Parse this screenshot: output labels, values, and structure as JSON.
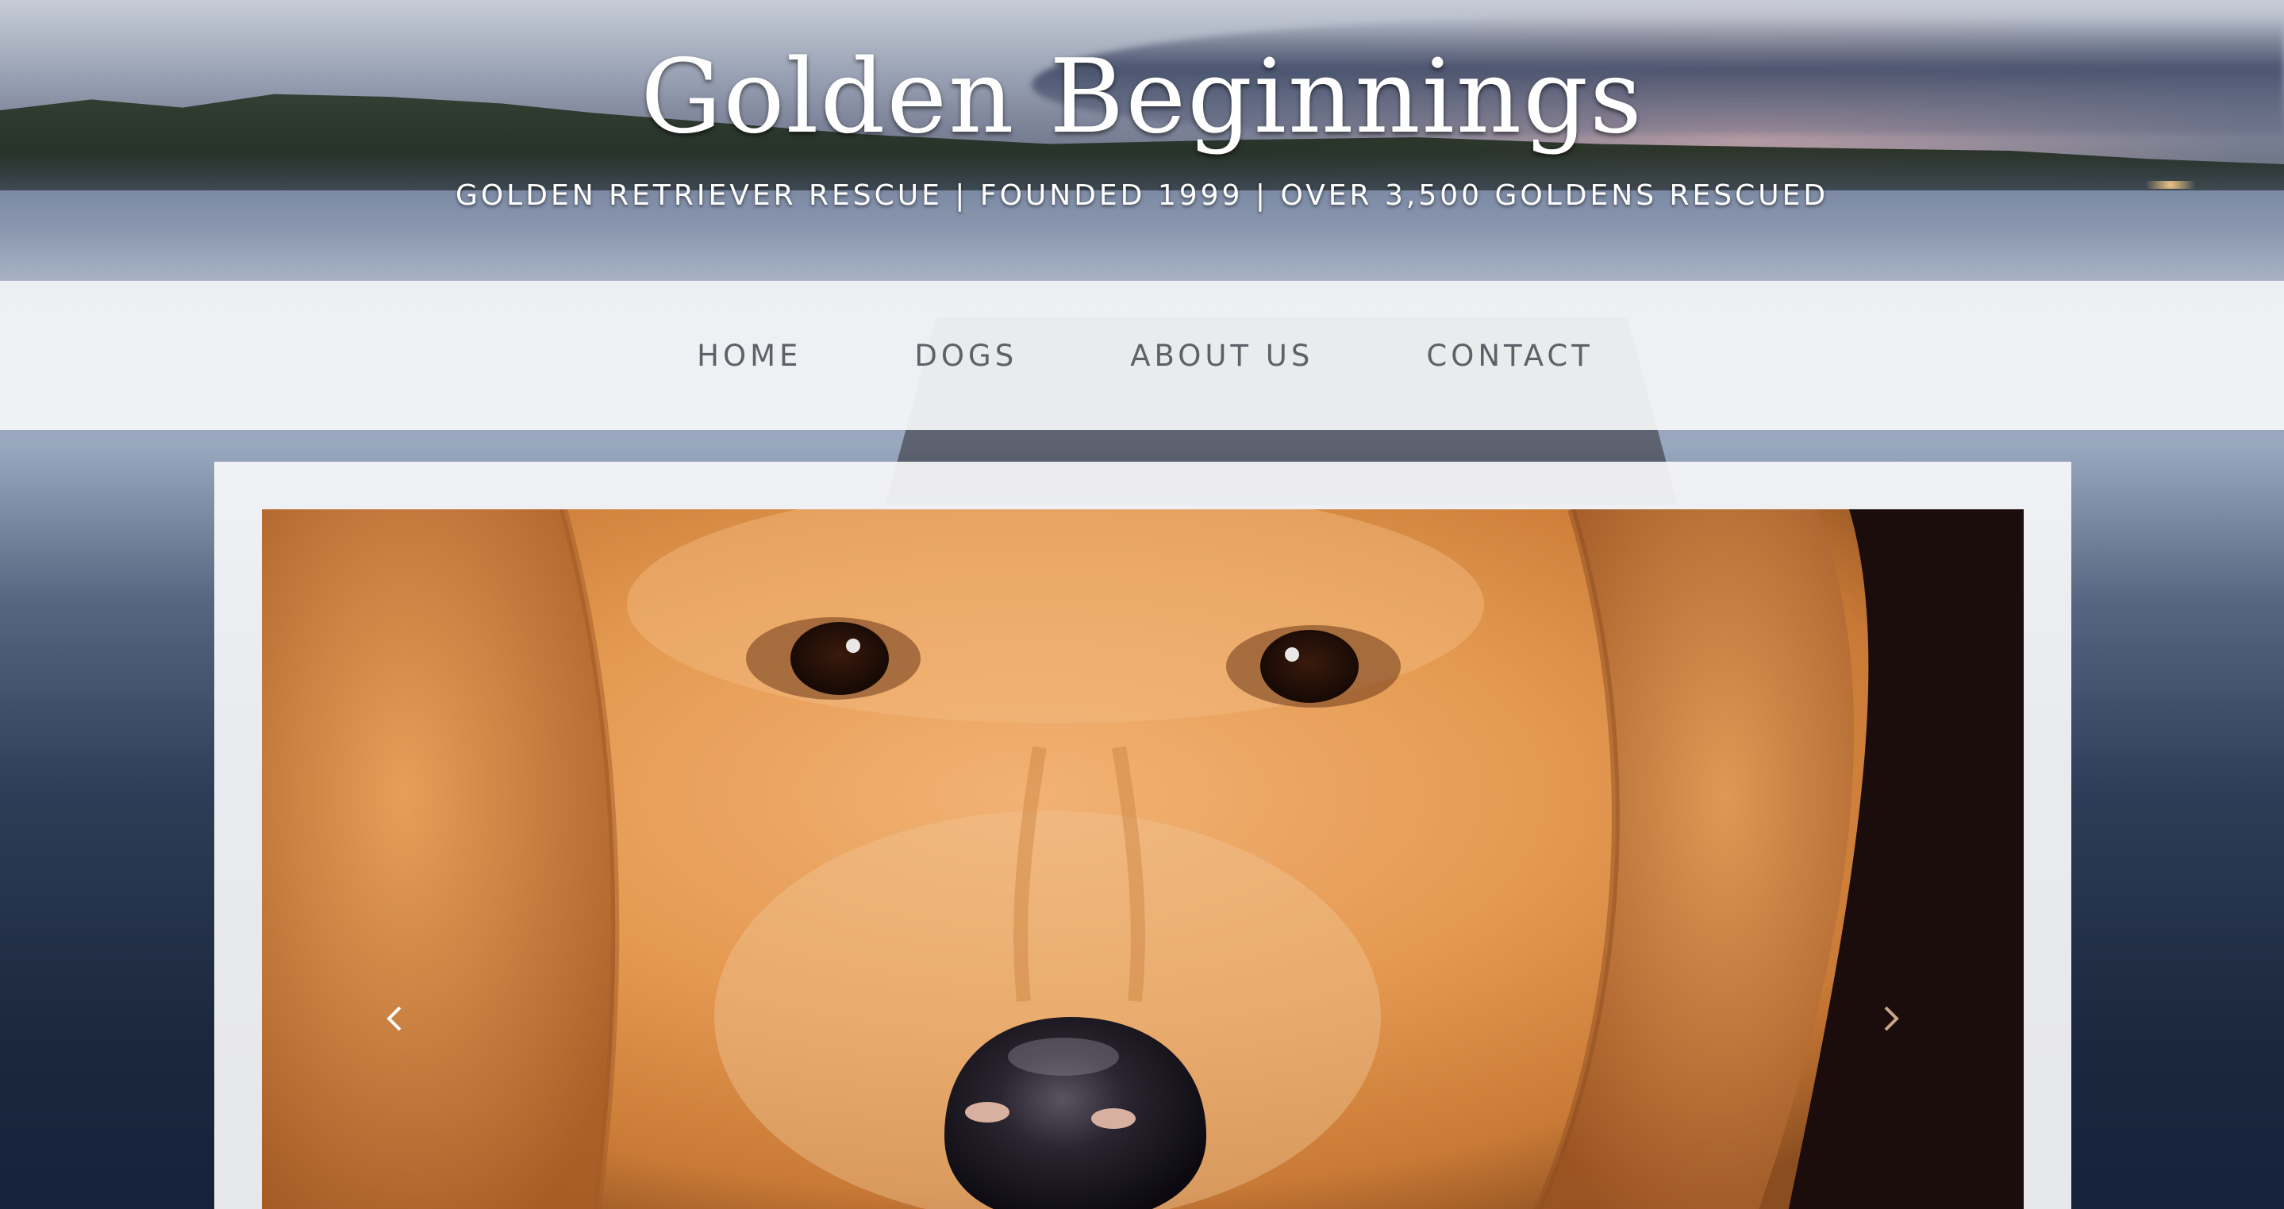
{
  "site": {
    "title": "Golden Beginnings",
    "tagline": "GOLDEN RETRIEVER RESCUE | FOUNDED 1999 | OVER 3,500 GOLDENS RESCUED"
  },
  "nav": {
    "items": [
      {
        "label": "HOME"
      },
      {
        "label": "DOGS"
      },
      {
        "label": "ABOUT US"
      },
      {
        "label": "CONTACT"
      }
    ]
  },
  "slider": {
    "prev_icon": "chevron-left-icon",
    "next_icon": "chevron-right-icon"
  },
  "colors": {
    "nav_text": "#5e6168",
    "title_text": "#ffffff",
    "nav_background": "#f8f9fb"
  }
}
